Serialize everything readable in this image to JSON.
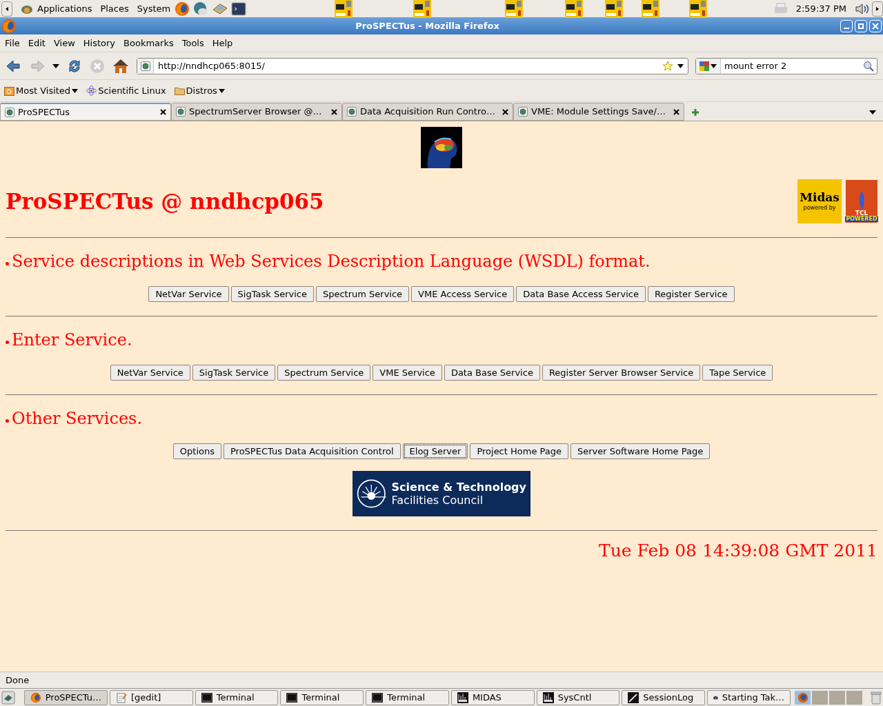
{
  "top_panel": {
    "menus": [
      "Applications",
      "Places",
      "System"
    ],
    "clock": "2:59:37 PM"
  },
  "window": {
    "title": "ProSPECTus - Mozilla Firefox"
  },
  "menu_bar": [
    "File",
    "Edit",
    "View",
    "History",
    "Bookmarks",
    "Tools",
    "Help"
  ],
  "nav_toolbar": {
    "url": "http://nndhcp065:8015/",
    "search": "mount error 2"
  },
  "bookmarks": [
    {
      "label": "Most Visited",
      "kind": "menu"
    },
    {
      "label": "Scientific Linux",
      "kind": "link"
    },
    {
      "label": "Distros",
      "kind": "folder"
    }
  ],
  "tabs": [
    {
      "label": "ProSPECTus",
      "selected": true
    },
    {
      "label": "SpectrumServer Browser @…",
      "selected": false
    },
    {
      "label": "Data Acquisition Run Contro…",
      "selected": false
    },
    {
      "label": "VME: Module Settings Save/…",
      "selected": false
    }
  ],
  "page": {
    "heading": "ProSPECTus @ nndhcp065",
    "logos": {
      "midas": "Midas",
      "midas_sub": "powered by",
      "tcl": "TCL",
      "tcl_sub": "POWERED"
    },
    "sections": [
      {
        "title": "Service descriptions in Web Services Description Language (WSDL) format.",
        "buttons": [
          {
            "label": "NetVar Service",
            "focused": false
          },
          {
            "label": "SigTask Service",
            "focused": false
          },
          {
            "label": "Spectrum Service",
            "focused": false
          },
          {
            "label": "VME Access Service",
            "focused": false
          },
          {
            "label": "Data Base Access Service",
            "focused": false
          },
          {
            "label": "Register Service",
            "focused": false
          }
        ]
      },
      {
        "title": "Enter Service.",
        "buttons": [
          {
            "label": "NetVar Service",
            "focused": false
          },
          {
            "label": "SigTask Service",
            "focused": false
          },
          {
            "label": "Spectrum Service",
            "focused": false
          },
          {
            "label": "VME Service",
            "focused": false
          },
          {
            "label": "Data Base Service",
            "focused": false
          },
          {
            "label": "Register Server Browser Service",
            "focused": false
          },
          {
            "label": "Tape Service",
            "focused": false
          }
        ]
      },
      {
        "title": "Other Services.",
        "buttons": [
          {
            "label": "Options",
            "focused": false
          },
          {
            "label": "ProSPECTus Data Acquisition Control",
            "focused": false
          },
          {
            "label": "Elog Server",
            "focused": true
          },
          {
            "label": "Project Home Page",
            "focused": false
          },
          {
            "label": "Server Software Home Page",
            "focused": false
          }
        ]
      }
    ],
    "stfc": {
      "line1": "Science & Technology",
      "line2": "Facilities Council"
    },
    "date": "Tue Feb 08 14:39:08 GMT 2011"
  },
  "status_bar": "Done",
  "taskbar": [
    {
      "label": "ProSPECTu…",
      "kind": "firefox",
      "selected": true
    },
    {
      "label": "[gedit]",
      "kind": "editor",
      "selected": false
    },
    {
      "label": "Terminal",
      "kind": "terminal",
      "selected": false
    },
    {
      "label": "Terminal",
      "kind": "terminal",
      "selected": false
    },
    {
      "label": "Terminal",
      "kind": "terminal",
      "selected": false
    },
    {
      "label": "MIDAS",
      "kind": "chart",
      "selected": false
    },
    {
      "label": "SysCntl",
      "kind": "chart",
      "selected": false
    },
    {
      "label": "SessionLog",
      "kind": "pen",
      "selected": false
    },
    {
      "label": "Starting Tak…",
      "kind": "camera",
      "selected": false
    }
  ],
  "workspaces": [
    {
      "selected": true
    },
    {
      "selected": false
    },
    {
      "selected": false
    },
    {
      "selected": false
    }
  ]
}
